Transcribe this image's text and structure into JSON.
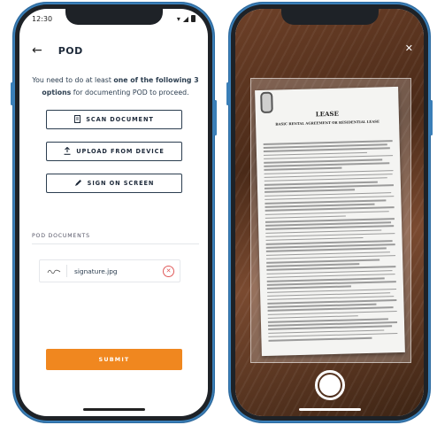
{
  "left_screen": {
    "status_time": "12:30",
    "title": "POD",
    "instruction_prefix": "You need to do at least ",
    "instruction_bold": "one of the following 3 options",
    "instruction_suffix": " for documenting POD to proceed.",
    "options": [
      {
        "label": "SCAN DOCUMENT",
        "icon": "document-icon"
      },
      {
        "label": "UPLOAD FROM DEVICE",
        "icon": "upload-icon"
      },
      {
        "label": "SIGN ON SCREEN",
        "icon": "pen-icon"
      }
    ],
    "section_label": "POD DOCUMENTS",
    "documents": [
      {
        "name": "signature.jpg"
      }
    ],
    "submit_label": "SUBMIT"
  },
  "right_screen": {
    "doc_title": "LEASE",
    "doc_subtitle": "BASIC RENTAL AGREEMENT OR RESIDENTIAL LEASE"
  },
  "colors": {
    "accent": "#f0871f",
    "text_dark": "#1e2a3a",
    "frame_blue": "#3a7fb8",
    "remove_red": "#e05a5a"
  }
}
